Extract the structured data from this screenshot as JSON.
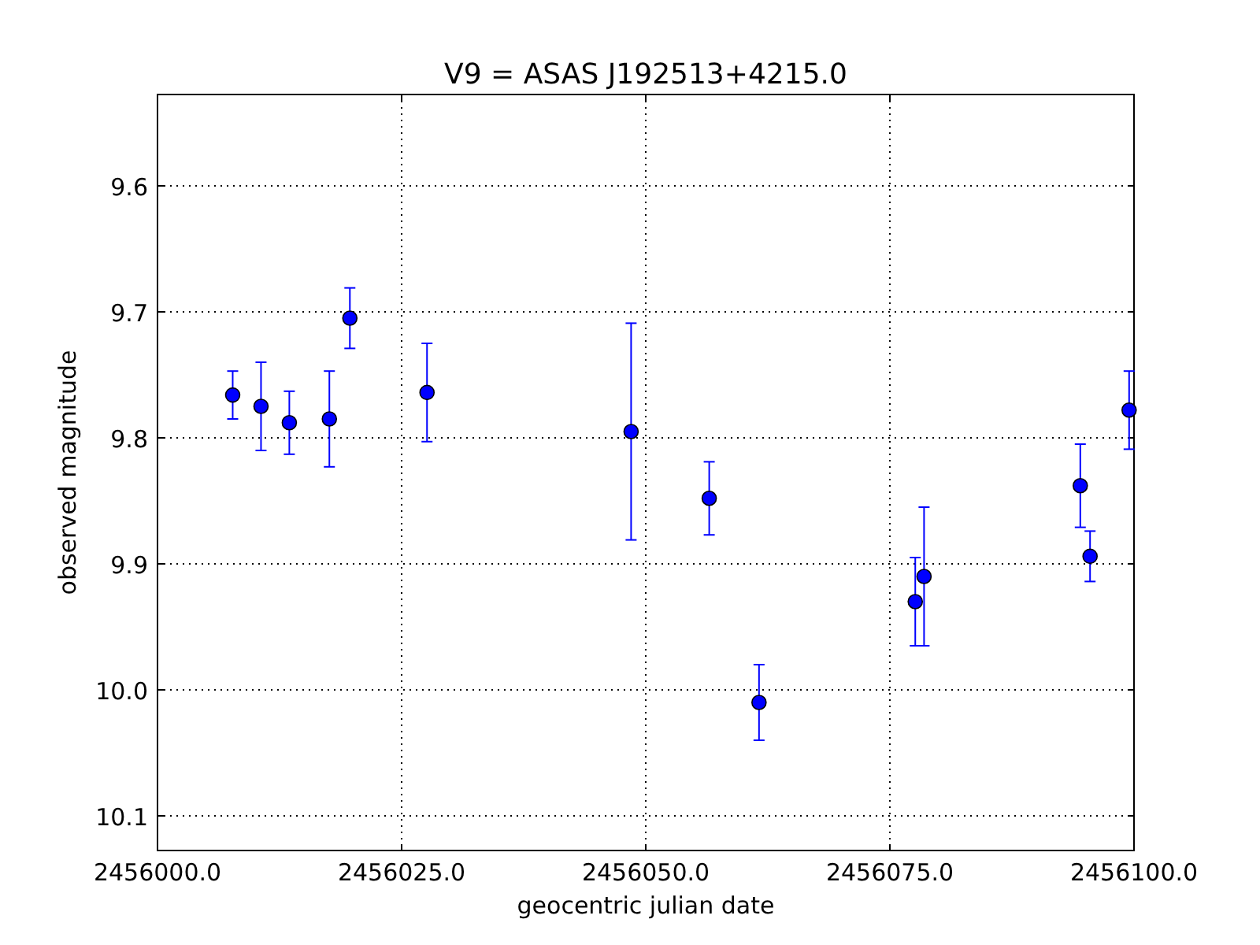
{
  "chart_data": {
    "type": "scatter",
    "title": "V9 = ASAS J192513+4215.0",
    "xlabel": "geocentric julian date",
    "ylabel": "observed magnitude",
    "x": [
      2456007.7,
      2456010.6,
      2456013.5,
      2456017.6,
      2456019.7,
      2456027.6,
      2456048.5,
      2456056.5,
      2456061.6,
      2456077.6,
      2456078.5,
      2456094.5,
      2456095.5,
      2456099.5
    ],
    "grid": true,
    "series": [
      {
        "color": "#0000ff",
        "values": [
          9.766,
          9.775,
          9.788,
          9.785,
          9.705,
          9.764,
          9.795,
          9.848,
          10.01,
          9.93,
          9.91,
          9.838,
          9.894,
          9.778
        ],
        "errors": [
          0.019,
          0.035,
          0.025,
          0.038,
          0.024,
          0.039,
          0.086,
          0.029,
          0.03,
          0.035,
          0.055,
          0.033,
          0.02,
          0.031
        ]
      }
    ],
    "xlim": [
      2456000,
      2456100
    ],
    "ylim": [
      10.1275,
      9.5275
    ],
    "xticks": [
      {
        "value": 2456000,
        "label": "2456000.0"
      },
      {
        "value": 2456025,
        "label": "2456025.0"
      },
      {
        "value": 2456050,
        "label": "2456050.0"
      },
      {
        "value": 2456075,
        "label": "2456075.0"
      },
      {
        "value": 2456100,
        "label": "2456100.0"
      }
    ],
    "yticks": [
      {
        "value": 9.6,
        "label": "9.6"
      },
      {
        "value": 9.7,
        "label": "9.7"
      },
      {
        "value": 9.8,
        "label": "9.8"
      },
      {
        "value": 9.9,
        "label": "9.9"
      },
      {
        "value": 10.0,
        "label": "10.0"
      },
      {
        "value": 10.1,
        "label": "10.1"
      }
    ]
  }
}
